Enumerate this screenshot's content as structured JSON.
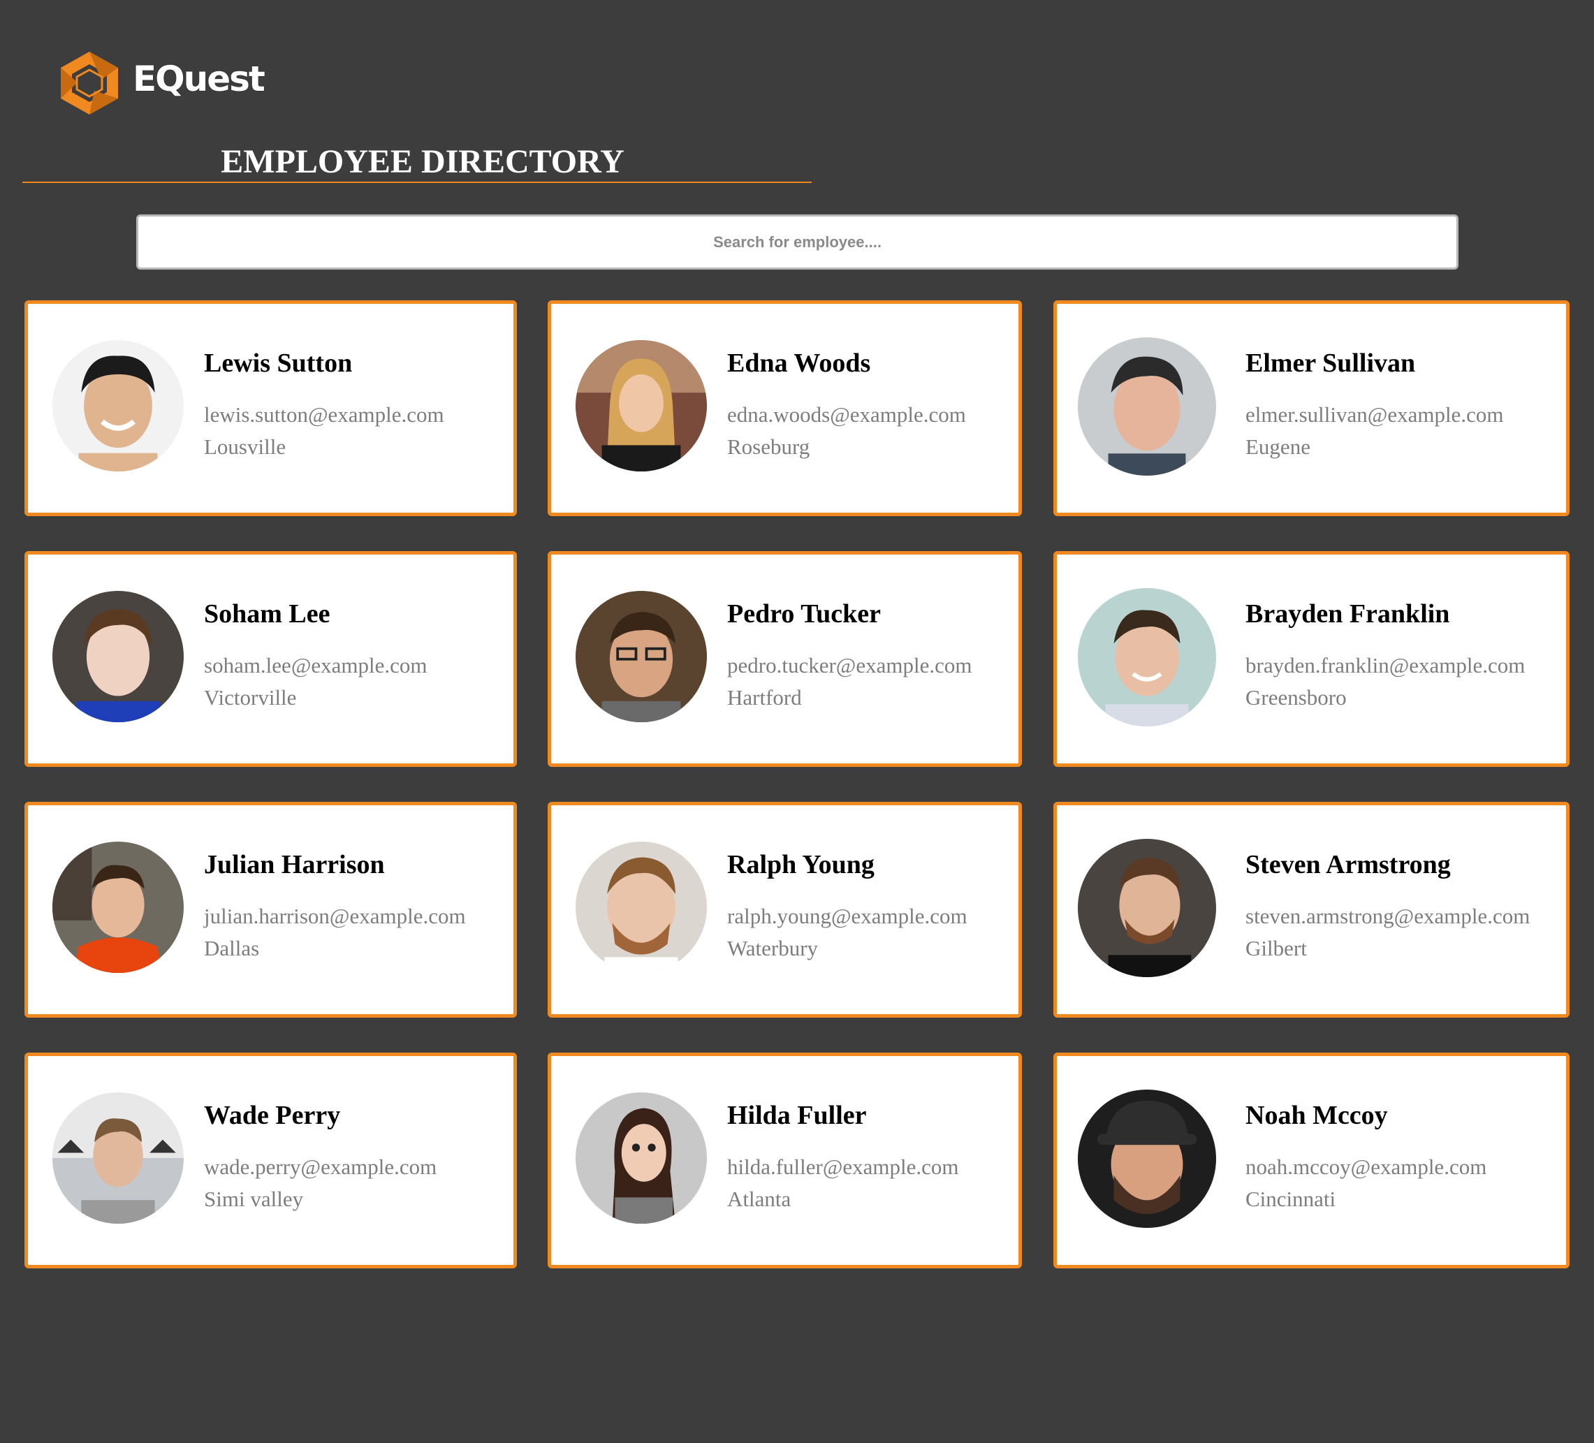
{
  "brand": {
    "name": "EQuest",
    "accent_color": "#f0891f",
    "logo_icon": "aperture-logo-icon"
  },
  "page": {
    "title": "EMPLOYEE DIRECTORY",
    "background": "#3d3d3d"
  },
  "search": {
    "placeholder": "Search for employee....",
    "value": ""
  },
  "employees": [
    {
      "name": "Lewis Sutton",
      "email": "lewis.sutton@example.com",
      "city": "Lousville"
    },
    {
      "name": "Edna Woods",
      "email": "edna.woods@example.com",
      "city": "Roseburg"
    },
    {
      "name": "Elmer Sullivan",
      "email": "elmer.sullivan@example.com",
      "city": "Eugene"
    },
    {
      "name": "Soham Lee",
      "email": "soham.lee@example.com",
      "city": "Victorville"
    },
    {
      "name": "Pedro Tucker",
      "email": "pedro.tucker@example.com",
      "city": "Hartford"
    },
    {
      "name": "Brayden Franklin",
      "email": "brayden.franklin@example.com",
      "city": "Greensboro"
    },
    {
      "name": "Julian Harrison",
      "email": "julian.harrison@example.com",
      "city": "Dallas"
    },
    {
      "name": "Ralph Young",
      "email": "ralph.young@example.com",
      "city": "Waterbury"
    },
    {
      "name": "Steven Armstrong",
      "email": "steven.armstrong@example.com",
      "city": "Gilbert"
    },
    {
      "name": "Wade Perry",
      "email": "wade.perry@example.com",
      "city": "Simi valley"
    },
    {
      "name": "Hilda Fuller",
      "email": "hilda.fuller@example.com",
      "city": "Atlanta"
    },
    {
      "name": "Noah Mccoy",
      "email": "noah.mccoy@example.com",
      "city": "Cincinnati"
    }
  ]
}
